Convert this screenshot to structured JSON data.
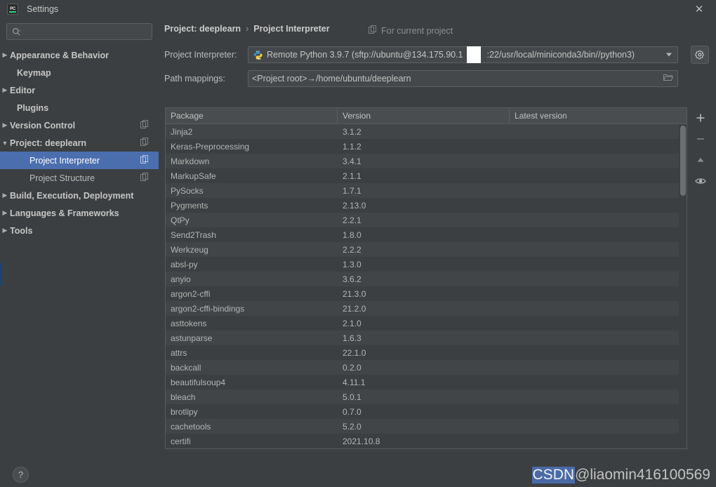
{
  "window": {
    "title": "Settings",
    "app_icon": "pycharm-logo-icon",
    "close_label": "✕",
    "accent_blue": "#4b6eaf",
    "bg": "#3c3f41"
  },
  "sidebar": {
    "search": {
      "placeholder": "",
      "value": "",
      "icon": "search-icon"
    },
    "items": [
      {
        "label": "Appearance & Behavior",
        "arrow": "▶",
        "indent": 10,
        "bold": true,
        "copy": false,
        "selected": false
      },
      {
        "label": "Keymap",
        "arrow": "",
        "indent": 24,
        "bold": true,
        "copy": false,
        "selected": false
      },
      {
        "label": "Editor",
        "arrow": "▶",
        "indent": 10,
        "bold": true,
        "copy": false,
        "selected": false
      },
      {
        "label": "Plugins",
        "arrow": "",
        "indent": 24,
        "bold": true,
        "copy": false,
        "selected": false
      },
      {
        "label": "Version Control",
        "arrow": "▶",
        "indent": 10,
        "bold": true,
        "copy": true,
        "selected": false
      },
      {
        "label": "Project: deeplearn",
        "arrow": "▼",
        "indent": 10,
        "bold": true,
        "copy": true,
        "selected": false
      },
      {
        "label": "Project Interpreter",
        "arrow": "",
        "indent": 42,
        "bold": false,
        "copy": true,
        "selected": true
      },
      {
        "label": "Project Structure",
        "arrow": "",
        "indent": 42,
        "bold": false,
        "copy": true,
        "selected": false
      },
      {
        "label": "Build, Execution, Deployment",
        "arrow": "▶",
        "indent": 10,
        "bold": true,
        "copy": false,
        "selected": false
      },
      {
        "label": "Languages & Frameworks",
        "arrow": "▶",
        "indent": 10,
        "bold": true,
        "copy": false,
        "selected": false
      },
      {
        "label": "Tools",
        "arrow": "▶",
        "indent": 10,
        "bold": true,
        "copy": false,
        "selected": false
      }
    ]
  },
  "main": {
    "breadcrumb": {
      "parent": "Project: deeplearn",
      "separator": "›",
      "current": "Project Interpreter"
    },
    "for_current_project": {
      "label": "For current project",
      "icon": "copy-icon"
    },
    "interpreter": {
      "label": "Project Interpreter:",
      "icon": "python-remote-icon",
      "value_before_redaction": "Remote Python 3.9.7 (sftp://ubuntu@134.175.90.1",
      "value_after_redaction": ":22/usr/local/miniconda3/bin//python3)",
      "dropdown_icon": "chevron-down-icon",
      "settings_button_icon": "gear-icon"
    },
    "path_mappings": {
      "label": "Path mappings:",
      "value": "<Project root>→/home/ubuntu/deeplearn",
      "browse_icon": "folder-icon"
    },
    "packages_table": {
      "columns": [
        "Package",
        "Version",
        "Latest version"
      ],
      "rows": [
        [
          "Jinja2",
          "3.1.2",
          ""
        ],
        [
          "Keras-Preprocessing",
          "1.1.2",
          ""
        ],
        [
          "Markdown",
          "3.4.1",
          ""
        ],
        [
          "MarkupSafe",
          "2.1.1",
          ""
        ],
        [
          "PySocks",
          "1.7.1",
          ""
        ],
        [
          "Pygments",
          "2.13.0",
          ""
        ],
        [
          "QtPy",
          "2.2.1",
          ""
        ],
        [
          "Send2Trash",
          "1.8.0",
          ""
        ],
        [
          "Werkzeug",
          "2.2.2",
          ""
        ],
        [
          "absl-py",
          "1.3.0",
          ""
        ],
        [
          "anyio",
          "3.6.2",
          ""
        ],
        [
          "argon2-cffi",
          "21.3.0",
          ""
        ],
        [
          "argon2-cffi-bindings",
          "21.2.0",
          ""
        ],
        [
          "asttokens",
          "2.1.0",
          ""
        ],
        [
          "astunparse",
          "1.6.3",
          ""
        ],
        [
          "attrs",
          "22.1.0",
          ""
        ],
        [
          "backcall",
          "0.2.0",
          ""
        ],
        [
          "beautifulsoup4",
          "4.11.1",
          ""
        ],
        [
          "bleach",
          "5.0.1",
          ""
        ],
        [
          "brotlipy",
          "0.7.0",
          ""
        ],
        [
          "cachetools",
          "5.2.0",
          ""
        ],
        [
          "certifi",
          "2021.10.8",
          ""
        ]
      ]
    },
    "side_toolbar": [
      {
        "name": "add-package-button",
        "icon": "plus-icon",
        "glyph": "+"
      },
      {
        "name": "remove-package-button",
        "icon": "minus-icon",
        "glyph": "−"
      },
      {
        "name": "upgrade-package-button",
        "icon": "arrow-up-icon",
        "glyph": "▲"
      },
      {
        "name": "show-early-releases-button",
        "icon": "eye-icon",
        "glyph": "◉"
      }
    ]
  },
  "footer": {
    "help_label": "?",
    "watermark_brand": "CSDN",
    "watermark_user": " @liaomin416100569"
  }
}
